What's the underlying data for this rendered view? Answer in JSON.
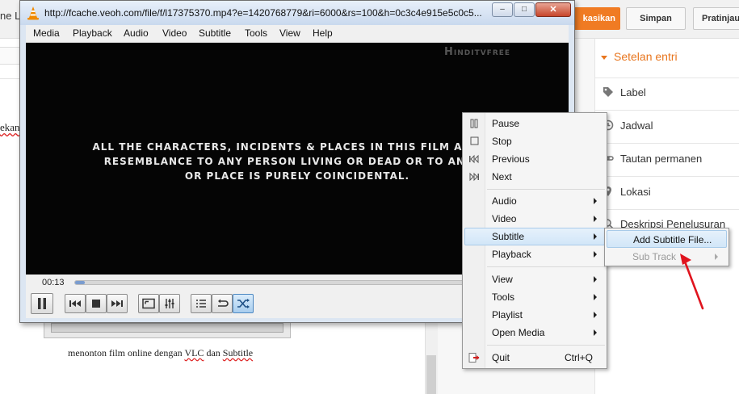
{
  "colors": {
    "accent_orange": "#e8761f",
    "highlight_blue": "#d2e6f8",
    "annotation_red": "#e0141e"
  },
  "background_editor": {
    "tab_fragment": "ne Le",
    "publish_label": "kasikan",
    "save_label": "Simpan",
    "preview_label": "Pratinjau",
    "body_fragment": "ekan",
    "caption_words": [
      "menonton film online dengan",
      "VLC",
      "dan",
      "Subtitle"
    ]
  },
  "sidebar": {
    "title": "Setelan entri",
    "items": [
      {
        "label": "Label",
        "icon": "tag-icon"
      },
      {
        "label": "Jadwal",
        "icon": "clock-icon"
      },
      {
        "label": "Tautan permanen",
        "icon": "link-icon"
      },
      {
        "label": "Lokasi",
        "icon": "location-pin-icon"
      },
      {
        "label": "Deskripsi Penelusuran",
        "icon": "search-description-icon"
      }
    ]
  },
  "vlc": {
    "title": "http://fcache.veoh.com/file/f/l17375370.mp4?e=1420768779&ri=6000&rs=100&h=0c3c4e915e5c0c5...",
    "window_buttons": {
      "minimize": "–",
      "maximize": "□",
      "close": "✕"
    },
    "menubar": [
      "Media",
      "Playback",
      "Audio",
      "Video",
      "Subtitle",
      "Tools",
      "View",
      "Help"
    ],
    "video": {
      "watermark": "Hinditvfree",
      "disclaimer_lines": [
        "ALL THE CHARACTERS, INCIDENTS & PLACES IN THIS FILM ARE FIC",
        "RESEMBLANCE TO ANY PERSON LIVING OR DEAD OR TO ANY IN",
        "OR PLACE IS PURELY COINCIDENTAL."
      ]
    },
    "time_elapsed": "00:13",
    "seek_progress": 0.02,
    "controls": [
      "pause-button",
      "previous-button",
      "stop-button",
      "next-button",
      "fullscreen-button",
      "extended-settings-button",
      "playlist-button",
      "loop-button",
      "random-button"
    ]
  },
  "context_menu": {
    "items": [
      {
        "label": "Pause",
        "icon": "pause-icon"
      },
      {
        "label": "Stop",
        "icon": "stop-icon"
      },
      {
        "label": "Previous",
        "icon": "previous-icon"
      },
      {
        "label": "Next",
        "icon": "next-icon"
      },
      {
        "label": "Audio",
        "submenu": true
      },
      {
        "label": "Video",
        "submenu": true
      },
      {
        "label": "Subtitle",
        "submenu": true,
        "highlighted": true
      },
      {
        "label": "Playback",
        "submenu": true
      },
      {
        "label": "View",
        "submenu": true
      },
      {
        "label": "Tools",
        "submenu": true
      },
      {
        "label": "Playlist",
        "submenu": true
      },
      {
        "label": "Open Media",
        "submenu": true
      },
      {
        "label": "Quit",
        "icon": "quit-icon",
        "shortcut": "Ctrl+Q"
      }
    ]
  },
  "subtitle_submenu": {
    "items": [
      {
        "label": "Add Subtitle File...",
        "highlighted": true
      },
      {
        "label": "Sub Track",
        "disabled": true,
        "submenu": true
      }
    ]
  }
}
